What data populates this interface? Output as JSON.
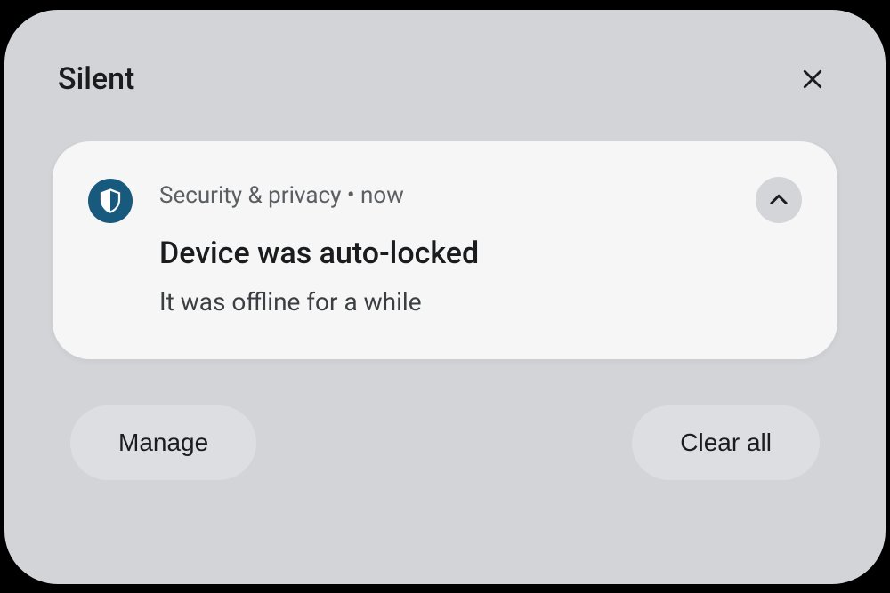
{
  "section": {
    "title": "Silent"
  },
  "notification": {
    "app_name": "Security & privacy",
    "separator": " • ",
    "time": "now",
    "title": "Device was auto-locked",
    "body": "It was offline for a while"
  },
  "actions": {
    "manage_label": "Manage",
    "clear_all_label": "Clear all"
  }
}
